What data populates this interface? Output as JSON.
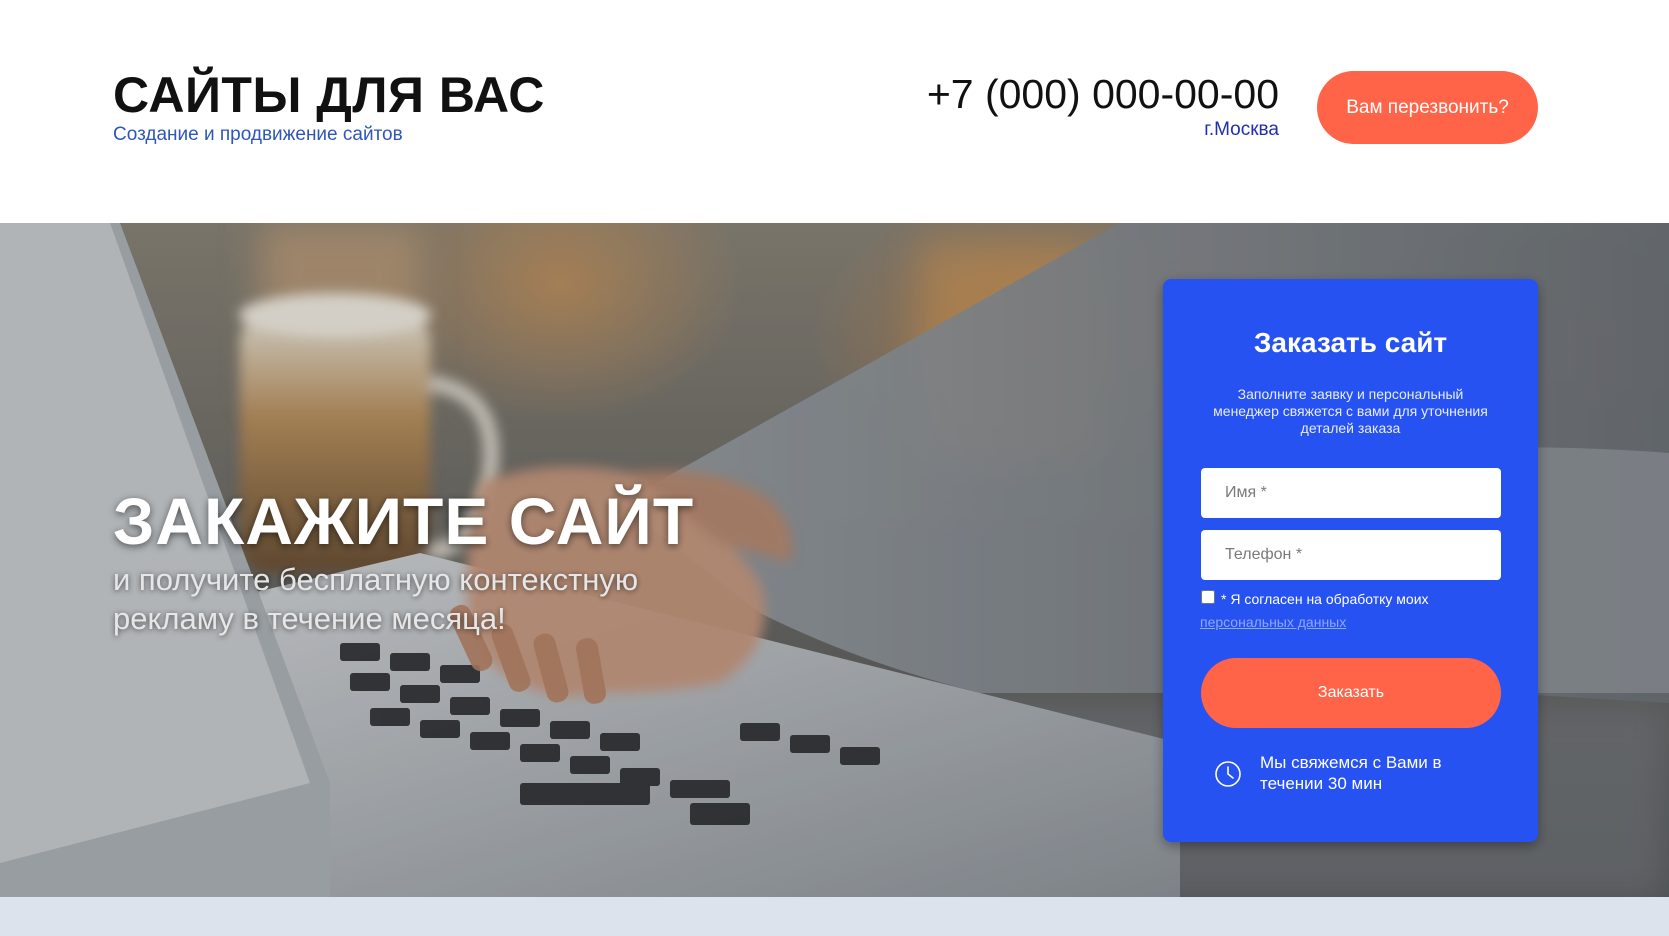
{
  "header": {
    "brand_title": "САЙТЫ ДЛЯ ВАС",
    "brand_subtitle": "Создание и продвижение сайтов",
    "phone": "+7 (000) 000-00-00",
    "city": "г.Москва",
    "callback_label": "Вам перезвонить?"
  },
  "hero": {
    "title": "ЗАКАЖИТЕ САЙТ",
    "subtitle": "и получите бесплатную контекстную рекламу в течение месяца!"
  },
  "order_form": {
    "title": "Заказать сайт",
    "description": "Заполните заявку и персональный менеджер свяжется с вами для уточнения деталей заказа",
    "name_placeholder": "Имя *",
    "name_value": "",
    "phone_placeholder": "Телефон *",
    "phone_value": "",
    "consent_checked": false,
    "consent_text": "* Я согласен на обработку моих",
    "consent_link": "персональных данных",
    "submit_label": "Заказать",
    "clock_icon": "clock-icon",
    "callback_note": "Мы свяжемся с Вами в течении 30 мин"
  },
  "colors": {
    "accent": "#ff6448",
    "card_blue": "#2752f2",
    "subtitle_blue": "#2f57b8",
    "strip": "#dde3ec"
  }
}
